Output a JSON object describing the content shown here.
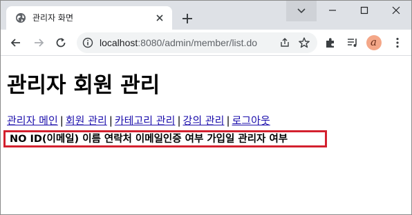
{
  "browser": {
    "tab_title": "관리자 화면",
    "url_host": "localhost",
    "url_rest": ":8080/admin/member/list.do"
  },
  "page": {
    "title": "관리자 회원 관리",
    "nav": {
      "admin_main": "관리자 메인",
      "member_manage": "회원 관리",
      "category_manage": "카테고리 관리",
      "course_manage": "강의 관리",
      "logout": "로그아웃",
      "separator": "|"
    },
    "table": {
      "headers": [
        "NO",
        "ID(이메일)",
        "이름",
        "연락처",
        "이메일인증 여부",
        "가입일",
        "관리자 여부"
      ]
    }
  },
  "colors": {
    "highlight_border": "#d3202e",
    "link": "#1a0dab",
    "tab_strip": "#dee1e6"
  },
  "icons": [
    "globe-icon",
    "close-icon",
    "plus-icon",
    "chevron-down-icon",
    "minimize-icon",
    "maximize-icon",
    "window-close-icon",
    "back-arrow-icon",
    "forward-arrow-icon",
    "reload-icon",
    "info-icon",
    "share-icon",
    "star-icon",
    "extensions-icon",
    "reading-list-icon",
    "avatar",
    "kebab-menu-icon"
  ]
}
